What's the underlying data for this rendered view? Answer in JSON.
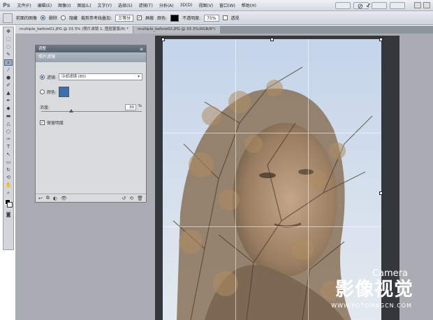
{
  "menu": {
    "logo": "Ps",
    "items": [
      "文件(F)",
      "编辑(E)",
      "图像(I)",
      "图层(L)",
      "文字(Y)",
      "选择(S)",
      "滤镜(T)",
      "分析(A)",
      "3D(D)",
      "视图(V)",
      "窗口(W)",
      "帮助(H)"
    ]
  },
  "options": {
    "label_frontal": "前面的图像",
    "radio_delete": "删除",
    "radio_hide": "隐藏",
    "label_crop_guide": "裁剪参考线叠加:",
    "crop_guide_value": "三等分",
    "check_shield": "屏蔽",
    "label_color": "颜色:",
    "label_opacity": "不透明度:",
    "opacity_value": "75%",
    "check_perspective": "透视",
    "cancel_icon": "⊘",
    "commit_icon": "✓"
  },
  "tabs": [
    "multiple_before01.JPG @ 33.3% (照片滤镜 1, 图层蒙版/8) *",
    "multiple_before02.JPG @ 33.3%(RGB/8*)"
  ],
  "panel": {
    "title": "调整",
    "subtitle": "照片滤镜",
    "filter_label": "滤镜:",
    "filter_value": "冷却滤镜 (80)",
    "color_label": "颜色:",
    "density_label": "浓度:",
    "density_value": "30",
    "density_unit": "%",
    "density_fraction": 0.3,
    "preserve_label": "保留明度",
    "filter_color": "#3c6fb0"
  },
  "watermark": {
    "camera": "Camera",
    "cn": "影像视觉",
    "url": "WWW.FOTOMAGCN.COM"
  }
}
